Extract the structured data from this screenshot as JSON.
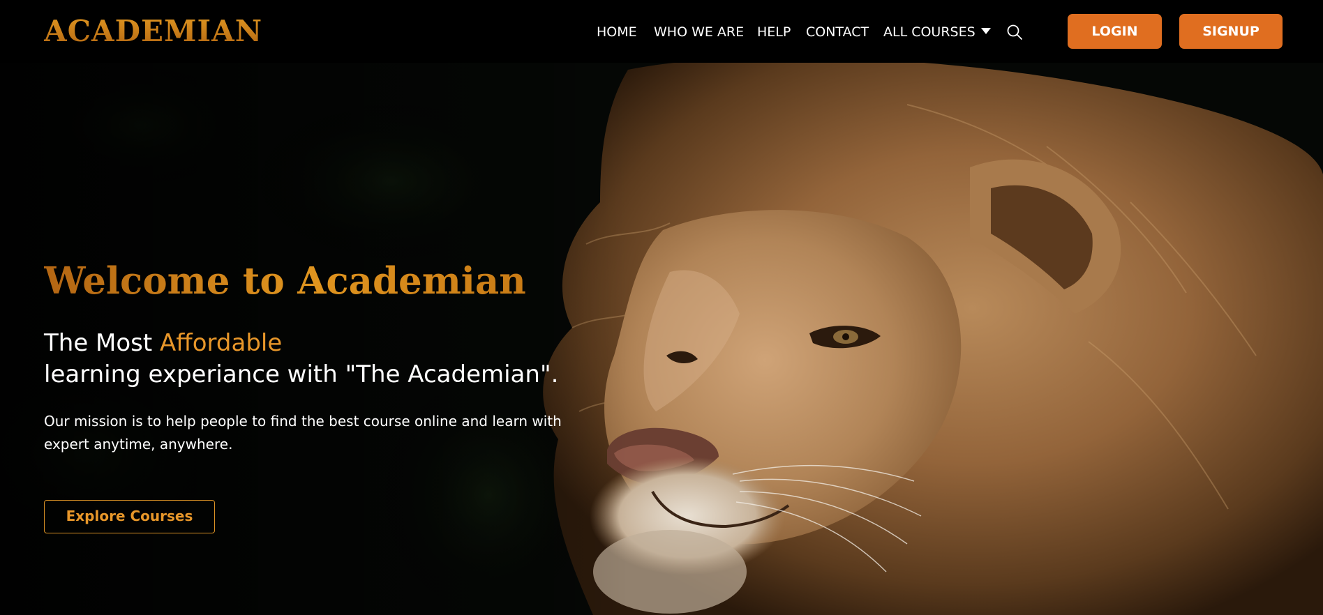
{
  "brand": {
    "logo_text": "ACADEMIAN",
    "accent_color": "#e06e20",
    "gold_color": "#d9891d"
  },
  "nav": {
    "items": [
      {
        "label": "HOME"
      },
      {
        "label": "WHO WE ARE"
      },
      {
        "label": "HELP"
      },
      {
        "label": "CONTACT"
      },
      {
        "label": "ALL COURSES",
        "has_dropdown": true
      }
    ],
    "search_icon": "search-icon",
    "login_label": "LOGIN",
    "signup_label": "SIGNUP"
  },
  "hero": {
    "title": "Welcome to Academian",
    "tagline_pre": "The Most ",
    "tagline_accent": "Affordable",
    "tagline_line2": "learning experiance with \"The Academian\".",
    "mission": "Our mission is to help people to find the best course online and learn with expert anytime, anywhere.",
    "cta_label": "Explore Courses",
    "background_image": "lion-portrait"
  }
}
